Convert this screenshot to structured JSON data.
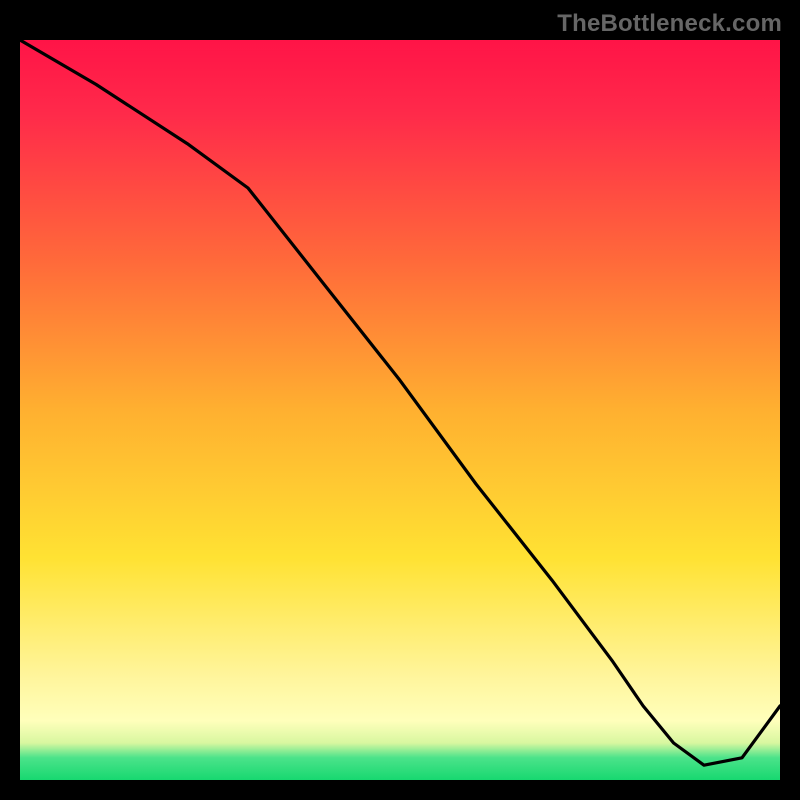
{
  "watermark": "TheBottleneck.com",
  "chart_data": {
    "type": "line",
    "title": "",
    "xlabel": "",
    "ylabel": "",
    "xlim": [
      0,
      100
    ],
    "ylim": [
      0,
      100
    ],
    "x": [
      0,
      10,
      22,
      30,
      40,
      50,
      60,
      70,
      78,
      82,
      86,
      90,
      95,
      100
    ],
    "values": [
      100,
      94,
      86,
      80,
      67,
      54,
      40,
      27,
      16,
      10,
      5,
      2,
      3,
      10
    ],
    "annotations": [
      {
        "text": "",
        "x": 82,
        "y": 3
      }
    ],
    "gradient_colors": [
      "#ff1447",
      "#ffb030",
      "#ffe233",
      "#ffffbb",
      "#17d870"
    ],
    "colors": {
      "curve": "#000000",
      "label": "#c0392b"
    }
  }
}
